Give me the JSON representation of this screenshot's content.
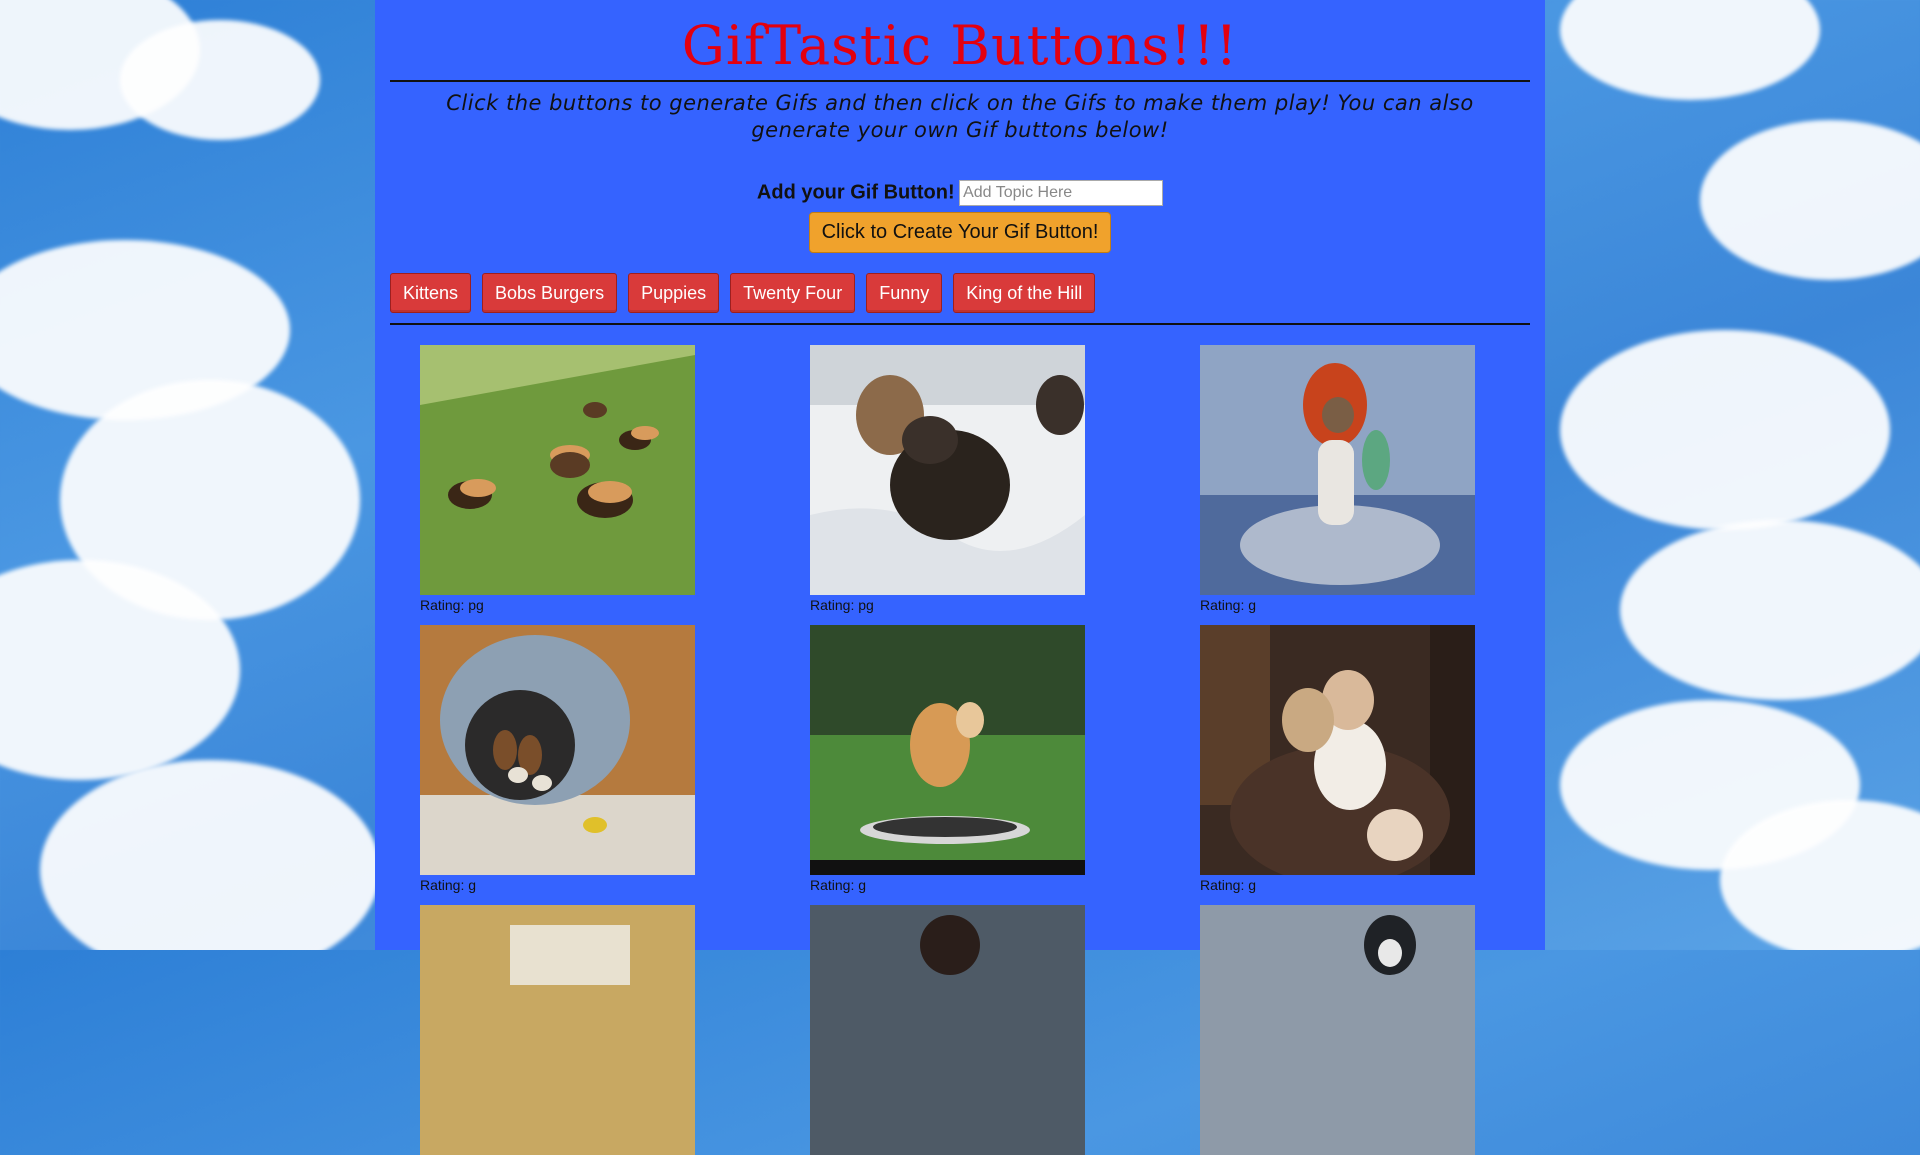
{
  "header": {
    "title": "GifTastic Buttons!!!",
    "subtitle": "Click the buttons to generate Gifs and then click on the Gifs to make them play! You can also generate your own Gif buttons below!"
  },
  "add_form": {
    "label": "Add your Gif Button!",
    "placeholder": "Add Topic Here",
    "value": "",
    "submit_label": "Click to Create Your Gif Button!"
  },
  "topics": [
    "Kittens",
    "Bobs Burgers",
    "Puppies",
    "Twenty Four",
    "Funny",
    "King of the Hill"
  ],
  "colors": {
    "panel": "#3563ff",
    "title": "#e3000f",
    "topic_button": "#d93a3a",
    "create_button": "#f0a22c"
  },
  "gifs": [
    {
      "rating_label": "Rating: pg",
      "scene": "dachshunds-in-hotdog-costumes-on-grass"
    },
    {
      "rating_label": "Rating: pg",
      "scene": "puppies-in-snow"
    },
    {
      "rating_label": "Rating: g",
      "scene": "dog-in-red-wig-mermaid-costume"
    },
    {
      "rating_label": "Rating: g",
      "scene": "puppies-in-dome-dog-bed"
    },
    {
      "rating_label": "Rating: g",
      "scene": "shiba-on-trampoline"
    },
    {
      "rating_label": "Rating: g",
      "scene": "woman-with-puppies-in-armchair"
    },
    {
      "rating_label": "",
      "scene": "partial-indoor-room"
    },
    {
      "rating_label": "",
      "scene": "partial-woman-in-snow"
    },
    {
      "rating_label": "",
      "scene": "partial-husky-in-snow"
    }
  ]
}
